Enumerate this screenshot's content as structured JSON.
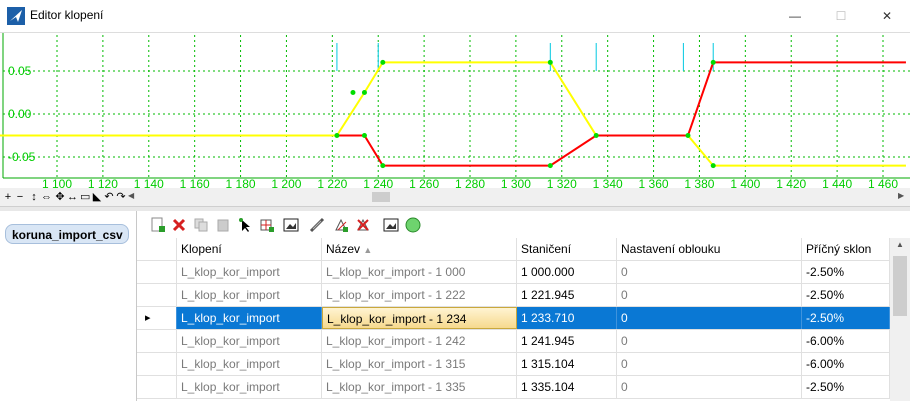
{
  "window": {
    "title": "Editor klopení",
    "minimize": "—",
    "maximize": "☐",
    "close": "✕"
  },
  "chart_data": {
    "type": "line",
    "xlim": [
      1050,
      1470
    ],
    "ylim": [
      -0.075,
      0.095
    ],
    "x_ticks": [
      1100,
      1120,
      1140,
      1160,
      1180,
      1200,
      1220,
      1240,
      1260,
      1280,
      1300,
      1320,
      1340,
      1360,
      1380,
      1400,
      1420,
      1440,
      1460
    ],
    "x_tick_labels": [
      "1 100",
      "1 120",
      "1 140",
      "1 160",
      "1 180",
      "1 200",
      "1 220",
      "1 240",
      "1 260",
      "1 280",
      "1 300",
      "1 320",
      "1 340",
      "1 360",
      "1 380",
      "1 400",
      "1 420",
      "1 440",
      "1 460"
    ],
    "y_ticks": [
      0.05,
      0.0,
      -0.05
    ],
    "y_tick_labels": [
      "0.05",
      "0.00",
      "-0.05"
    ],
    "grid": true,
    "series": [
      {
        "color": "#ffff00",
        "x": [
          1050,
          1222,
          1234,
          1242,
          1315,
          1335,
          1375,
          1386,
          1470
        ],
        "y": [
          -0.025,
          -0.025,
          0.025,
          0.06,
          0.06,
          -0.025,
          -0.025,
          -0.06,
          -0.06
        ]
      },
      {
        "color": "#ff0000",
        "x": [
          1222,
          1234,
          1242,
          1315,
          1335,
          1375,
          1386,
          1470
        ],
        "y": [
          -0.025,
          -0.025,
          -0.06,
          -0.06,
          -0.025,
          -0.025,
          0.06,
          0.06
        ]
      }
    ],
    "markers": [
      1222,
      1240,
      1315,
      1335,
      1373,
      1386
    ],
    "colors": {
      "axis_text": "#00cc00",
      "grid": "#00bb00",
      "marker": "#00c8e0",
      "point": "#00dd00"
    }
  },
  "chart_toolbar": {
    "icons": [
      "zoom-in-icon",
      "zoom-out-icon",
      "fit-vertical-icon",
      "fit-horizontal-icon",
      "fit-all-icon",
      "pan-icon",
      "window-icon",
      "graph-icon",
      "undo-icon",
      "redo-icon"
    ]
  },
  "datasets": {
    "active": "koruna_import_csv"
  },
  "grid": {
    "columns": [
      "",
      "Klopení",
      "Název",
      "Staničení",
      "Nastavení oblouku",
      "Příčný sklon"
    ],
    "sort_indicator": "▲",
    "rows": [
      {
        "klopeni": "L_klop_kor_import",
        "nazev": "L_klop_kor_import - 1 000",
        "staniceni": "1 000.000",
        "nastaveni": "0",
        "sklon": "-2.50%"
      },
      {
        "klopeni": "L_klop_kor_import",
        "nazev": "L_klop_kor_import - 1 222",
        "staniceni": "1 221.945",
        "nastaveni": "0",
        "sklon": "-2.50%"
      },
      {
        "klopeni": "L_klop_kor_import",
        "nazev": "L_klop_kor_import - 1 234",
        "staniceni": "1 233.710",
        "nastaveni": "0",
        "sklon": "-2.50%"
      },
      {
        "klopeni": "L_klop_kor_import",
        "nazev": "L_klop_kor_import - 1 242",
        "staniceni": "1 241.945",
        "nastaveni": "0",
        "sklon": "-6.00%"
      },
      {
        "klopeni": "L_klop_kor_import",
        "nazev": "L_klop_kor_import - 1 315",
        "staniceni": "1 315.104",
        "nastaveni": "0",
        "sklon": "-6.00%"
      },
      {
        "klopeni": "L_klop_kor_import",
        "nazev": "L_klop_kor_import - 1 335",
        "staniceni": "1 335.104",
        "nastaveni": "0",
        "sklon": "-2.50%"
      }
    ],
    "selected_index": 2
  }
}
